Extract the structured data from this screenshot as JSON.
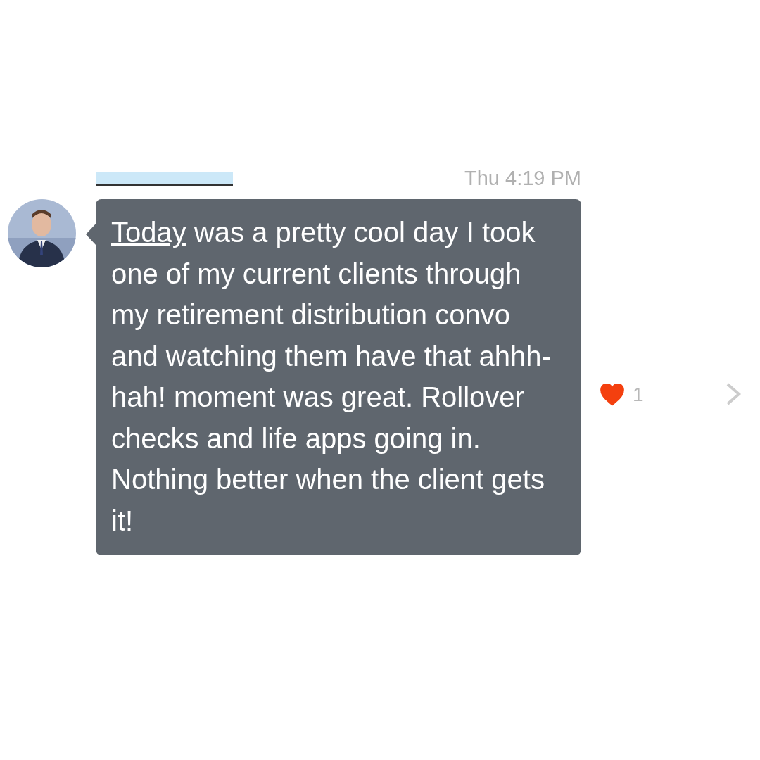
{
  "message": {
    "time": "Thu 4:19 PM",
    "link": "Today",
    "text": " was a pretty cool day I took one of my current clients through my retirement distribution convo and watching them have that ahhh-hah! moment was great. Rollover checks and life apps going in. Nothing better when the client gets it!",
    "liked": true,
    "likes": "1"
  }
}
